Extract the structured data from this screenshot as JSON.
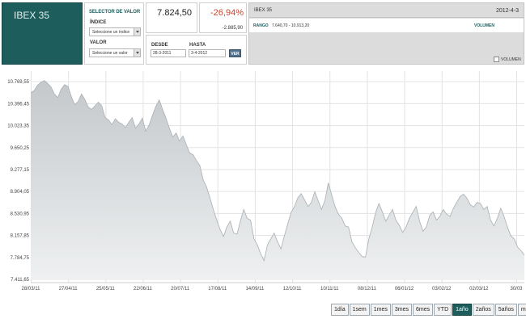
{
  "brand": {
    "title": "IBEX 35"
  },
  "selector": {
    "title": "SELECTOR DE VALOR",
    "index_label": "ÍNDICE",
    "index_value": "Seleccione un índice",
    "value_label": "VALOR",
    "value_value": "Seleccione un valor"
  },
  "quote": {
    "price": "7.824,50",
    "change_pct": "-26,94%",
    "change_abs": "-2.885,90"
  },
  "dates": {
    "from_label": "DESDE",
    "from_value": "28-3-2011",
    "to_label": "HASTA",
    "to_value": "3-4-2012",
    "submit_label": "VER"
  },
  "info": {
    "name": "IBEX 35",
    "date": "2012-4-3",
    "range_label": "RANGO",
    "range_value": "7.640,70 - 10.913,20",
    "volume_label": "VOLUMEN",
    "volume_checkbox_label": "VOLUMEN"
  },
  "colors": {
    "brand": "#1d5d5b",
    "negative": "#c8452f",
    "area_top": "#c4c8cb",
    "area_bottom": "#eef0f1"
  },
  "ranges": {
    "buttons": [
      "1día",
      "1sem",
      "1mes",
      "3mes",
      "6mes",
      "YTD",
      "1año",
      "2años",
      "5años",
      "máx."
    ],
    "active": "1año"
  },
  "chart_data": {
    "type": "area",
    "title": "",
    "xlabel": "",
    "ylabel": "",
    "ylim": [
      7411.65,
      10950
    ],
    "y_ticks": [
      "10.769,55",
      "10.396,45",
      "10.023,35",
      "9.650,25",
      "9.277,15",
      "8.904,05",
      "8.530,95",
      "8.157,85",
      "7.784,75",
      "7.411,65"
    ],
    "x_ticks": [
      "28/03/11",
      "27/04/11",
      "25/05/11",
      "22/06/11",
      "20/07/11",
      "17/08/11",
      "14/09/11",
      "12/10/11",
      "10/11/11",
      "08/12/11",
      "06/01/12",
      "03/02/12",
      "02/03/12",
      "30/03"
    ],
    "grid": true,
    "series": [
      {
        "values": [
          10580,
          10620,
          10710,
          10760,
          10790,
          10740,
          10680,
          10560,
          10500,
          10640,
          10720,
          10690,
          10520,
          10380,
          10430,
          10560,
          10470,
          10340,
          10300,
          10360,
          10420,
          10360,
          10160,
          10120,
          10040,
          10140,
          10080,
          10050,
          9990,
          10080,
          10160,
          9980,
          10050,
          10150,
          9930,
          10030,
          10200,
          10350,
          10460,
          10300,
          10150,
          9980,
          9830,
          9900,
          9760,
          9850,
          9700,
          9560,
          9530,
          9430,
          9350,
          9100,
          8980,
          8800,
          8600,
          8420,
          8260,
          8140,
          8300,
          8400,
          8200,
          8180,
          8400,
          8600,
          8450,
          8420,
          8100,
          8000,
          7850,
          7730,
          8000,
          8100,
          8200,
          8050,
          7930,
          8150,
          8350,
          8550,
          8650,
          8800,
          8870,
          8760,
          8650,
          8720,
          8900,
          8750,
          8600,
          8750,
          9050,
          8850,
          8650,
          8520,
          8450,
          8320,
          8300,
          8050,
          7950,
          7870,
          7800,
          7790,
          8100,
          8300,
          8550,
          8700,
          8560,
          8400,
          8500,
          8600,
          8420,
          8330,
          8210,
          8300,
          8450,
          8550,
          8650,
          8400,
          8230,
          8300,
          8500,
          8560,
          8420,
          8480,
          8600,
          8520,
          8480,
          8620,
          8720,
          8820,
          8860,
          8790,
          8680,
          8640,
          8720,
          8700,
          8600,
          8650,
          8420,
          8320,
          8450,
          8620,
          8480,
          8300,
          8150,
          8100,
          7960,
          7900,
          7824
        ]
      }
    ]
  }
}
